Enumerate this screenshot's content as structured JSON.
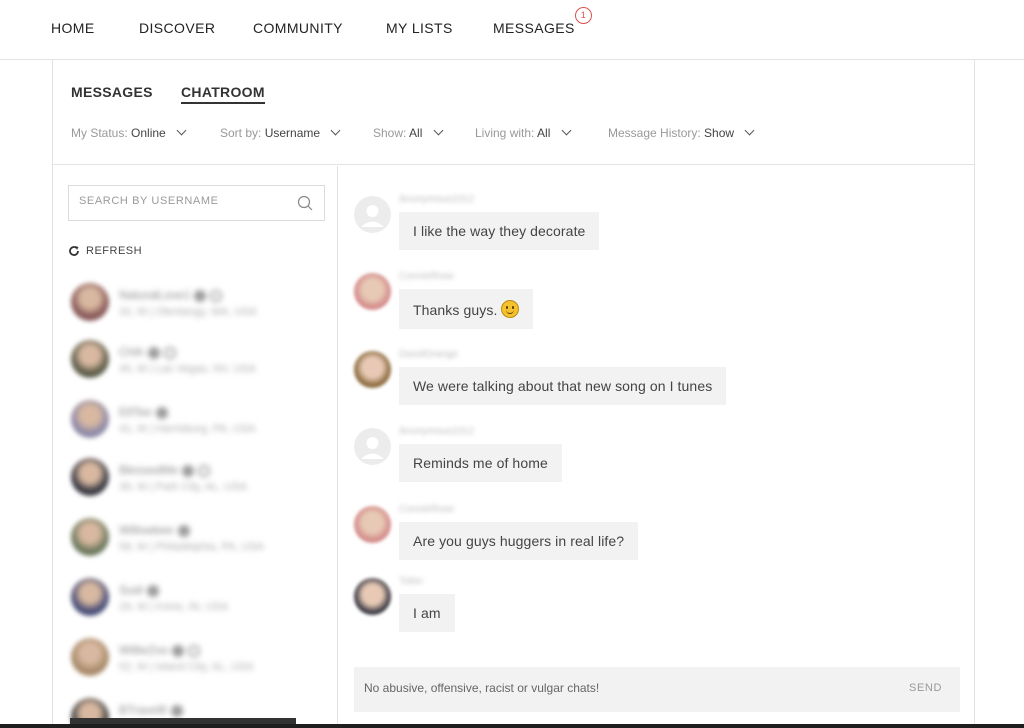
{
  "topnav": {
    "items": [
      {
        "label": "HOME"
      },
      {
        "label": "DISCOVER"
      },
      {
        "label": "COMMUNITY"
      },
      {
        "label": "MY LISTS"
      },
      {
        "label": "MESSAGES",
        "badge": "1"
      }
    ]
  },
  "subtabs": [
    {
      "label": "MESSAGES",
      "active": false
    },
    {
      "label": "CHATROOM",
      "active": true
    }
  ],
  "filters": [
    {
      "label": "My Status:",
      "value": "Online"
    },
    {
      "label": "Sort by:",
      "value": "Username"
    },
    {
      "label": "Show:",
      "value": "All"
    },
    {
      "label": "Living with:",
      "value": "All"
    },
    {
      "label": "Message History:",
      "value": "Show"
    }
  ],
  "sidebar": {
    "search_placeholder": "SEARCH BY USERNAME",
    "refresh_label": "REFRESH",
    "users": [
      {
        "name": "NaturalLove1",
        "location": "32, M | Olentangy, WA, USA",
        "avatar_color": "#8a5a5a"
      },
      {
        "name": "Chih",
        "location": "45, M | Las Vegas, NV, USA",
        "avatar_color": "#5d5d4a"
      },
      {
        "name": "EllTee",
        "location": "41, M | Harrisburg, PA, USA",
        "avatar_color": "#8f8aa8"
      },
      {
        "name": "BlessedMe",
        "location": "36, M | Park City, AL, USA",
        "avatar_color": "#3b3b44"
      },
      {
        "name": "Willowbee",
        "location": "58, M | Philadelphia, PA, USA",
        "avatar_color": "#6d7a5e"
      },
      {
        "name": "Sudi",
        "location": "29, M | Irvine, IN, USA",
        "avatar_color": "#4a4f78"
      },
      {
        "name": "WillieZoo",
        "location": "52, M | Island City, AL, USA",
        "avatar_color": "#a88b6a"
      },
      {
        "name": "BTravel8",
        "location": "",
        "avatar_color": "#444444"
      }
    ]
  },
  "chat": {
    "messages": [
      {
        "user": "Anonymous1012",
        "text": "I like the way they decorate",
        "avatar": "default",
        "emoji": ""
      },
      {
        "user": "ConnieRose",
        "text": "Thanks guys.",
        "avatar": "#d48b8b",
        "emoji": "smiley"
      },
      {
        "user": "DavidOrange",
        "text": "We were talking about that new song on I tunes",
        "avatar": "#8b6b3d",
        "emoji": ""
      },
      {
        "user": "Anonymous1012",
        "text": "Reminds me of home",
        "avatar": "default",
        "emoji": ""
      },
      {
        "user": "ConnieRose",
        "text": "Are you guys huggers in real life?",
        "avatar": "#d48b8b",
        "emoji": ""
      },
      {
        "user": "Tobin",
        "text": "I am",
        "avatar": "#3b3b44",
        "emoji": ""
      }
    ],
    "compose_placeholder": "No abusive, offensive, racist or vulgar chats!",
    "send_label": "SEND"
  }
}
